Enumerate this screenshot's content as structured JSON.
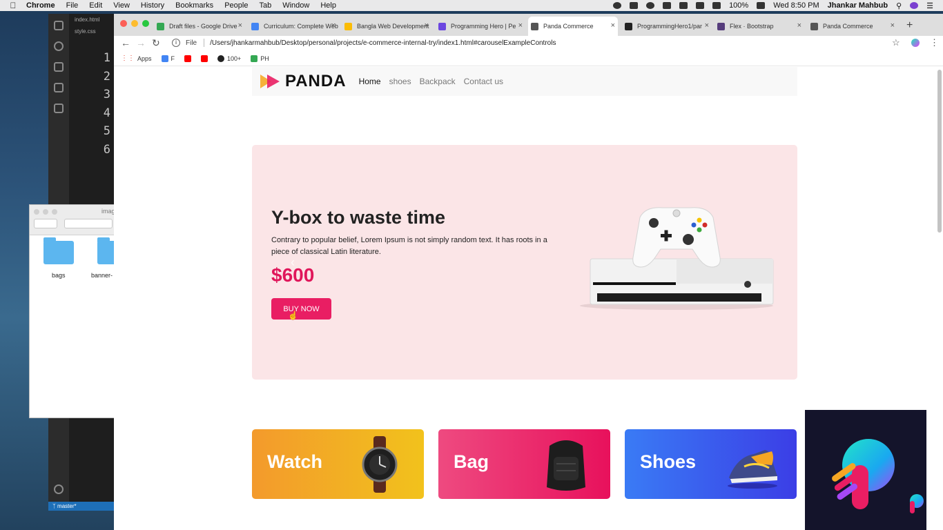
{
  "menubar": {
    "app": "Chrome",
    "items": [
      "File",
      "Edit",
      "View",
      "History",
      "Bookmarks",
      "People",
      "Tab",
      "Window",
      "Help"
    ],
    "battery": "100%",
    "time": "Wed 8:50 PM",
    "user": "Jhankar Mahbub"
  },
  "vscode": {
    "tabs": [
      "index.html",
      "style.css"
    ],
    "line_numbers": [
      "1",
      "2",
      "3",
      "4",
      "5",
      "6"
    ],
    "status_branch": "master*"
  },
  "finder": {
    "title": "imag",
    "folders": [
      "bags",
      "banner-"
    ]
  },
  "browser": {
    "tabs": [
      {
        "title": "Draft files - Google Drive",
        "color": "#34a853"
      },
      {
        "title": "Curriculum: Complete Web",
        "color": "#4285f4"
      },
      {
        "title": "Bangla Web Development",
        "color": "#fbbc05"
      },
      {
        "title": "Programming Hero | Pe",
        "color": "#6b46e0"
      },
      {
        "title": "Panda Commerce",
        "color": "#555555"
      },
      {
        "title": "ProgrammingHero1/par",
        "color": "#222222"
      },
      {
        "title": "Flex · Bootstrap",
        "color": "#563d7c"
      },
      {
        "title": "Panda Commerce",
        "color": "#555555"
      }
    ],
    "active_tab": 4,
    "address_label": "File",
    "url": "/Users/jhankarmahbub/Desktop/personal/projects/e-commerce-internal-try/index1.html#carouselExampleControls",
    "bookmarks": [
      {
        "label": "Apps",
        "color": "#e24c3b"
      },
      {
        "label": "F",
        "color": "#4285f4"
      },
      {
        "label": "",
        "color": "#ff0000"
      },
      {
        "label": "",
        "color": "#ff0000"
      },
      {
        "label": "100+",
        "color": "#222222"
      },
      {
        "label": "PH",
        "color": "#34a853"
      }
    ]
  },
  "site": {
    "brand": "PANDA",
    "nav": [
      "Home",
      "shoes",
      "Backpack",
      "Contact us"
    ],
    "hero": {
      "title": "Y-box to waste time",
      "description": "Contrary to popular belief, Lorem Ipsum is not simply random text. It has roots in a piece of classical Latin literature.",
      "price": "$600",
      "button": "BUY NOW"
    },
    "categories": [
      {
        "label": "Watch",
        "gradient_from": "#f39a2c",
        "gradient_to": "#f2c21c"
      },
      {
        "label": "Bag",
        "gradient_from": "#ee4a80",
        "gradient_to": "#e8115c"
      },
      {
        "label": "Shoes",
        "gradient_from": "#3a7bf5",
        "gradient_to": "#3b3ee6"
      }
    ]
  },
  "icons": {
    "back": "back-arrow-icon",
    "forward": "forward-arrow-icon",
    "reload": "reload-icon",
    "star": "bookmark-star-icon",
    "extension": "extension-icon",
    "menu": "menu-dots-icon"
  }
}
